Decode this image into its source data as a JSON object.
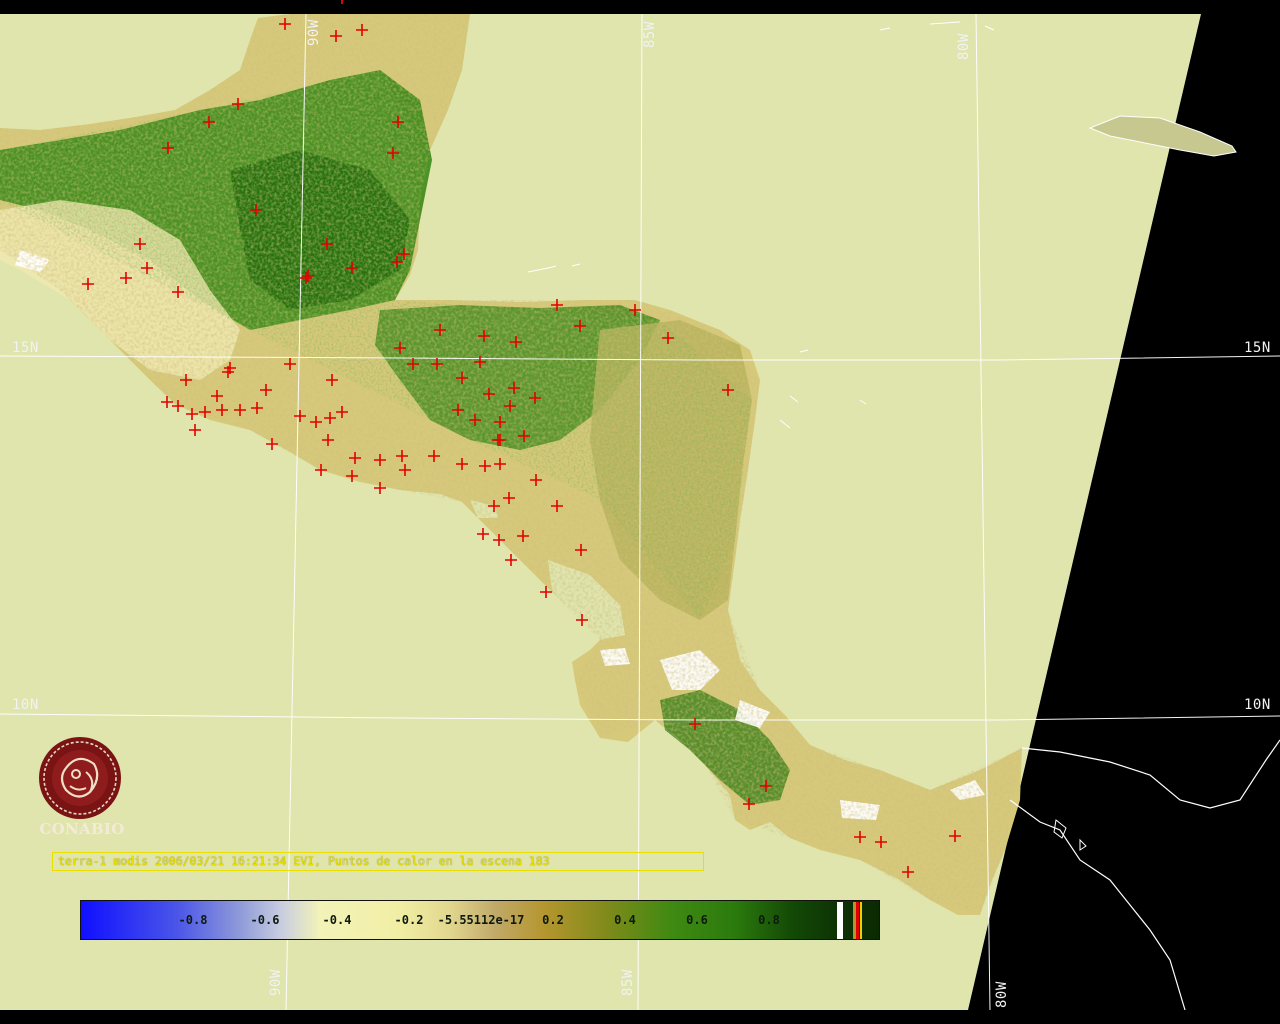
{
  "map": {
    "grid_labels": {
      "lat_15_left": "15N",
      "lat_15_right": "15N",
      "lat_10_left": "10N",
      "lat_10_right": "10N",
      "lon_90_top": "90W",
      "lon_85_top": "85W",
      "lon_80_top": "80W",
      "lon_90_bottom": "90W",
      "lon_85_bottom": "85W",
      "lon_80_bottom": "80W"
    },
    "logo_caption": "CONABIO",
    "caption": "terra-1 modis 2006/03/21 16:21:34 EVI, Puntos de calor en la escena 183",
    "colorbar": {
      "ticks": [
        "-0.8",
        "-0.6",
        "-0.4",
        "-0.2",
        "-5.55112e-17",
        "0.2",
        "0.4",
        "0.6",
        "0.8"
      ],
      "min": -1.0,
      "max": 1.0
    },
    "colors": {
      "ocean": "#dfe5ad",
      "nodata": "#000000",
      "hotspot": "#e40000",
      "grid": "#ffffff",
      "caption": "#e9e000",
      "logo": "#7a1414"
    }
  }
}
